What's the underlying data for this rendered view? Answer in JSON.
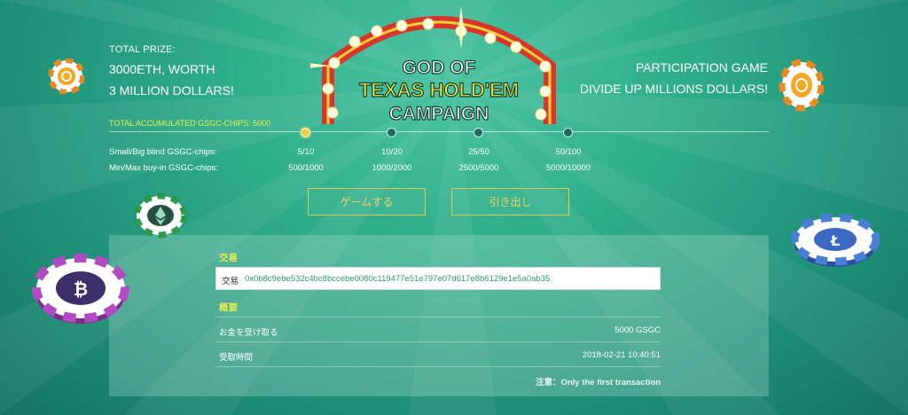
{
  "prize": {
    "label": "TOTAL PRIZE:",
    "line1": "3000ETH, WORTH",
    "line2": "3 MILLION DOLLARS!"
  },
  "participation": {
    "line1": "PARTICIPATION GAME",
    "line2": "DIVIDE UP MILLIONS DOLLARS!"
  },
  "logo": {
    "line1": "GOD OF",
    "line2": "TEXAS HOLD'EM",
    "line3": "CAMPAIGN"
  },
  "accumulated": "TOTAL ACCUMULATED GSGC-CHIPS: 5000",
  "levels": {
    "blind_label": "Small/Big blind GSGC-chips:",
    "buyin_label": "Min/Max buy-in GSGC-chips:",
    "active_index": 0,
    "items": [
      {
        "blind": "5/10",
        "buyin": "500/1000"
      },
      {
        "blind": "10/20",
        "buyin": "1000/2000"
      },
      {
        "blind": "25/50",
        "buyin": "2500/5000"
      },
      {
        "blind": "50/100",
        "buyin": "5000/10000"
      }
    ]
  },
  "buttons": {
    "play": "ゲームする",
    "withdraw": "引き出し"
  },
  "transaction": {
    "section_title": "交易",
    "key": "交易",
    "hash": "0x0b8c9ebe532c4bc8bccebe0080c119477e51e797e07d617e8b6129e1e5a0ab35"
  },
  "summary": {
    "section_title": "概要",
    "rows": [
      {
        "key": "お金を受け取る",
        "value": "5000 GSGC"
      },
      {
        "key": "受取時間",
        "value": "2018-02-21 10:40:51"
      }
    ],
    "note": "注意：Only the first transaction"
  },
  "colors": {
    "accent_yellow": "#e6f04a",
    "button_gold": "#e3c74a",
    "background": "#2fae8c"
  },
  "icons": [
    "coin-chip-icon",
    "ethereum-chip-icon",
    "bitcoin-chip-icon",
    "litecoin-chip-icon"
  ]
}
